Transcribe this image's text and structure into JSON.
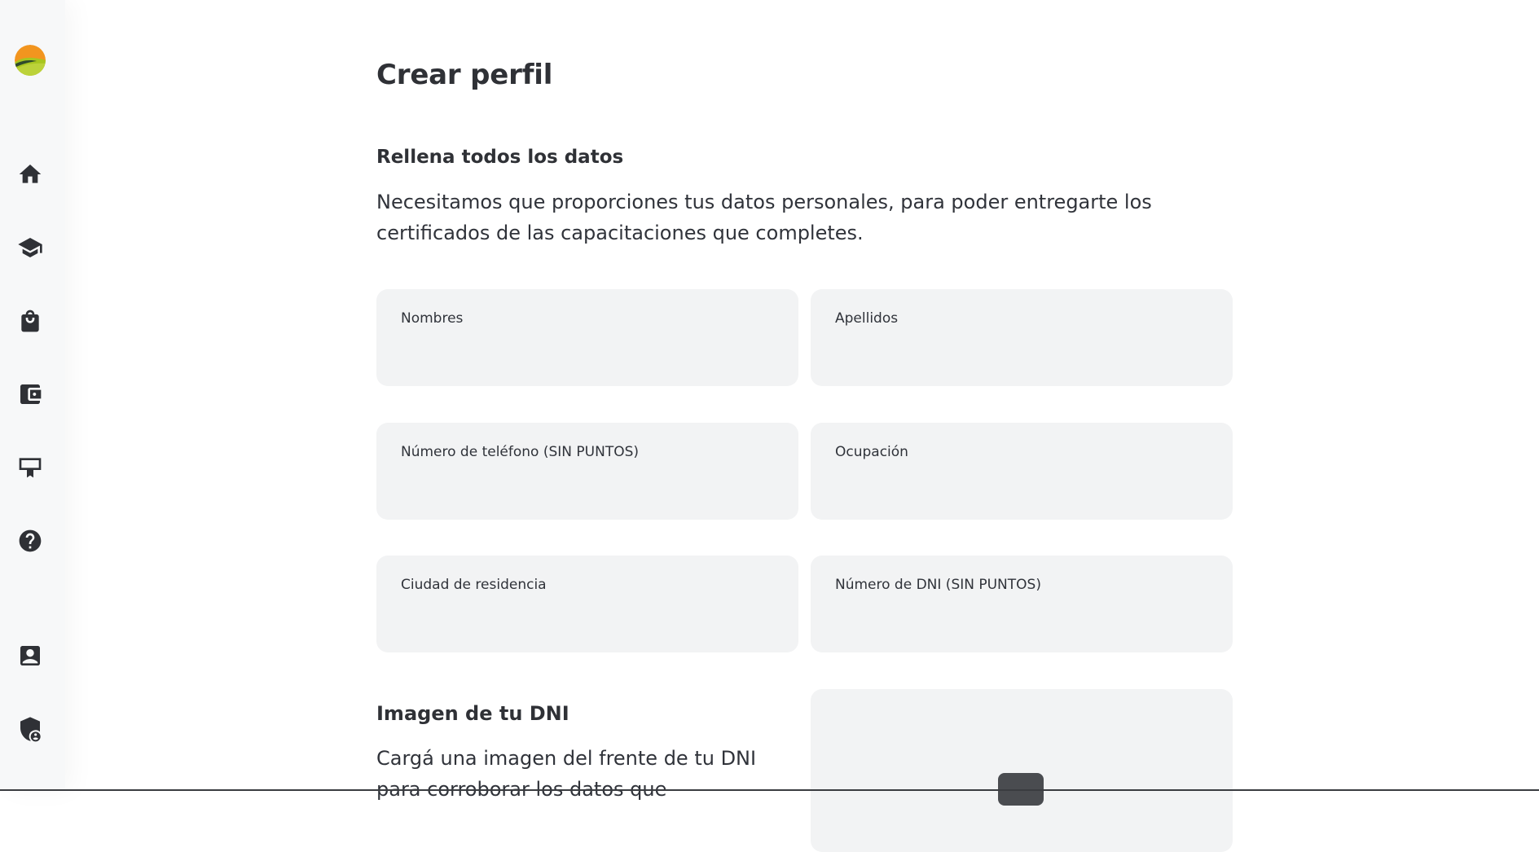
{
  "sidebar": {
    "logo": "sunrise-hills-logo",
    "items": [
      {
        "icon": "home-icon"
      },
      {
        "icon": "graduation-cap-icon"
      },
      {
        "icon": "shopping-bag-icon"
      },
      {
        "icon": "wallet-icon"
      },
      {
        "icon": "certificate-icon"
      },
      {
        "icon": "help-icon"
      },
      {
        "icon": "profile-card-icon"
      },
      {
        "icon": "privacy-shield-icon"
      }
    ]
  },
  "page": {
    "title": "Crear perfil",
    "section_title": "Rellena todos los datos",
    "section_description": "Necesitamos que proporciones tus datos personales, para poder entregarte los certificados de las capacitaciones que completes."
  },
  "form": {
    "nombres": {
      "label": "Nombres",
      "value": ""
    },
    "apellidos": {
      "label": "Apellidos",
      "value": ""
    },
    "telefono": {
      "label": "Número de teléfono (SIN PUNTOS)",
      "value": ""
    },
    "ocupacion": {
      "label": "Ocupación",
      "value": ""
    },
    "ciudad": {
      "label": "Ciudad de residencia",
      "value": ""
    },
    "dni": {
      "label": "Número de DNI (SIN PUNTOS)",
      "value": ""
    }
  },
  "dni_image": {
    "title": "Imagen de tu DNI",
    "description": "Cargá una imagen del frente de tu DNI para corroborar los datos que"
  },
  "colors": {
    "text": "#2f3136",
    "field_bg": "#f2f3f4",
    "sidebar_bg": "#f7f8f9",
    "logo_orange": "#f2951f",
    "logo_green": "#a8c61f"
  }
}
